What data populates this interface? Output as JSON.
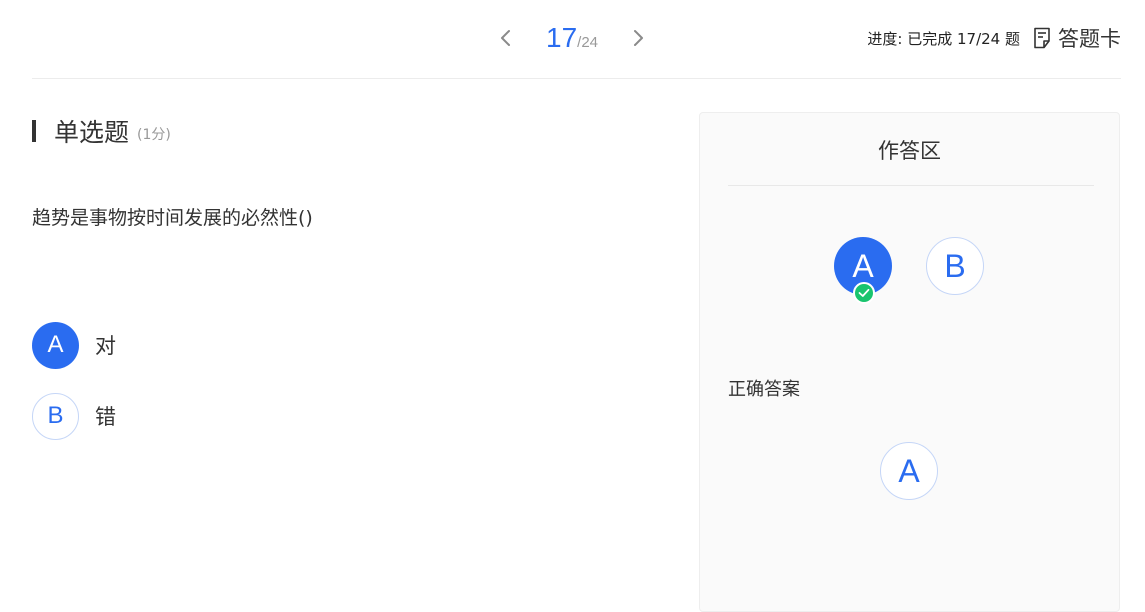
{
  "pager": {
    "current": "17",
    "total": "/24"
  },
  "progress": {
    "text": "进度: 已完成 17/24 题",
    "answer_card_label": "答题卡"
  },
  "question": {
    "type": "单选题",
    "score": "(1分)",
    "text": "趋势是事物按时间发展的必然性()",
    "options": [
      {
        "letter": "A",
        "text": "对",
        "selected": true
      },
      {
        "letter": "B",
        "text": "错",
        "selected": false
      }
    ]
  },
  "answer_panel": {
    "title": "作答区",
    "choices": [
      {
        "letter": "A",
        "selected": true
      },
      {
        "letter": "B",
        "selected": false
      }
    ],
    "correct_label": "正确答案",
    "correct_answer": "A"
  },
  "colors": {
    "accent": "#2a6cf0",
    "success": "#19c46e"
  },
  "icons": {
    "prev": "chevron-left-icon",
    "next": "chevron-right-icon",
    "answer_card": "document-icon",
    "check": "check-circle-icon"
  }
}
